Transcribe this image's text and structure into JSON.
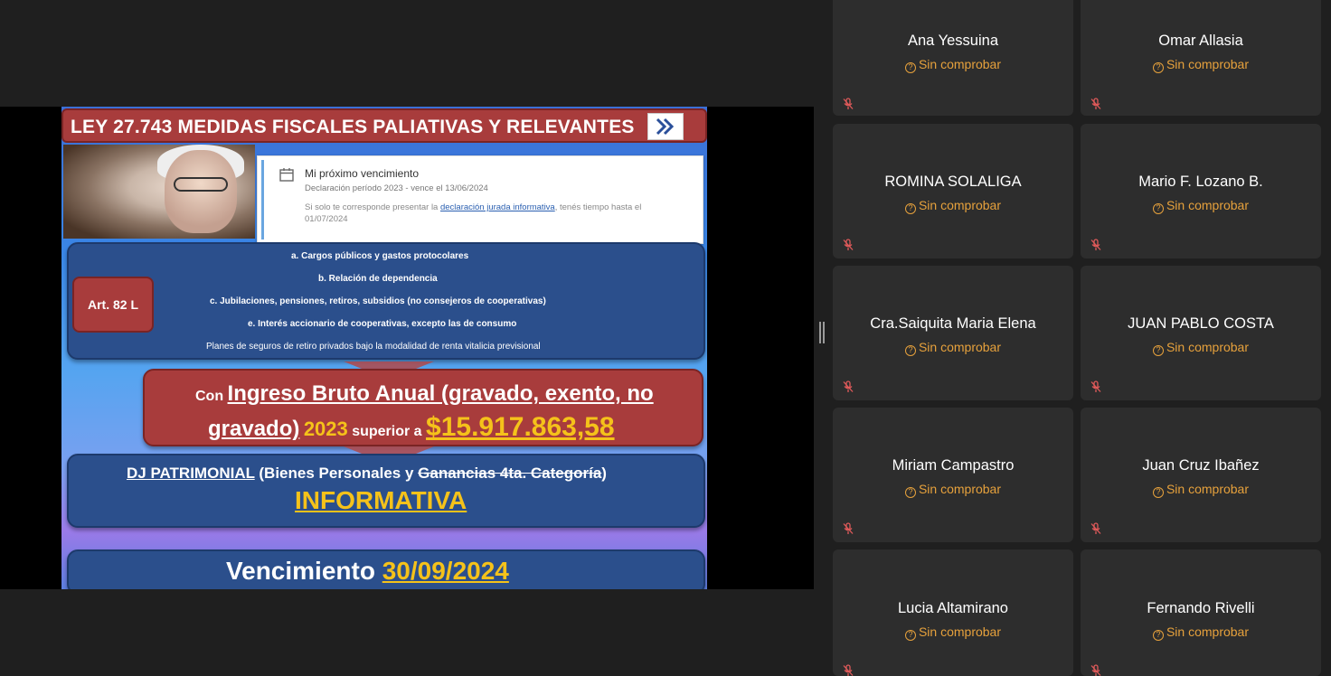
{
  "slide": {
    "title": "LEY 27.743 MEDIDAS FISCALES PALIATIVAS Y RELEVANTES",
    "due_card": {
      "heading": "Mi próximo vencimiento",
      "subheading": "Declaración período 2023 - vence el 13/06/2024",
      "note_prefix": "Si solo te corresponde presentar la ",
      "note_link": "declaración jurada informativa",
      "note_suffix": ", tenés tiempo hasta el 01/07/2024"
    },
    "article_badge": "Art. 82 L",
    "list": [
      "a.        Cargos públicos y gastos protocolares",
      "b.        Relación de dependencia",
      "c.        Jubilaciones, pensiones, retiros, subsidios (no consejeros de cooperativas)",
      "e. Interés accionario de cooperativas, excepto las de consumo",
      "Planes de seguros de retiro privados bajo la modalidad de renta vitalicia previsional"
    ],
    "income": {
      "con": "Con ",
      "ingreso_a": "Ingreso Bruto Anual (gravado, exento, no",
      "ingreso_b": "gravado)",
      "year": "2023",
      "superior": " superior a ",
      "amount": "$15.917.863,58"
    },
    "dj": {
      "label_u": "DJ PATRIMONIAL",
      "label_mid": " (Bienes Personales y ",
      "label_strike": "Ganancias 4ta. Categoría",
      "label_end": ")",
      "type": "INFORMATIVA"
    },
    "deadline": {
      "label": "Vencimiento ",
      "date": "30/09/2024"
    }
  },
  "participants": [
    {
      "name": "Ana Yessuina",
      "status": "Sin comprobar"
    },
    {
      "name": "Omar Allasia",
      "status": "Sin comprobar"
    },
    {
      "name": "ROMINA SOLALIGA",
      "status": "Sin comprobar"
    },
    {
      "name": "Mario F. Lozano B.",
      "status": "Sin comprobar"
    },
    {
      "name": "Cra.Saiquita Maria Elena",
      "status": "Sin comprobar"
    },
    {
      "name": "JUAN PABLO COSTA",
      "status": "Sin comprobar"
    },
    {
      "name": "Miriam Campastro",
      "status": "Sin comprobar"
    },
    {
      "name": "Juan Cruz Ibañez",
      "status": "Sin comprobar"
    },
    {
      "name": "Lucia Altamirano",
      "status": "Sin comprobar"
    },
    {
      "name": "Fernando Rivelli",
      "status": "Sin comprobar"
    }
  ],
  "icons": {
    "status": "question-circle-icon",
    "mic": "mic-muted-icon",
    "calendar": "calendar-icon"
  },
  "colors": {
    "status": "#e6a13c",
    "tile_bg": "#2d2d2d",
    "slide_red": "#a83c3c",
    "slide_blue": "#2b4f8c",
    "highlight": "#f5c21a"
  }
}
